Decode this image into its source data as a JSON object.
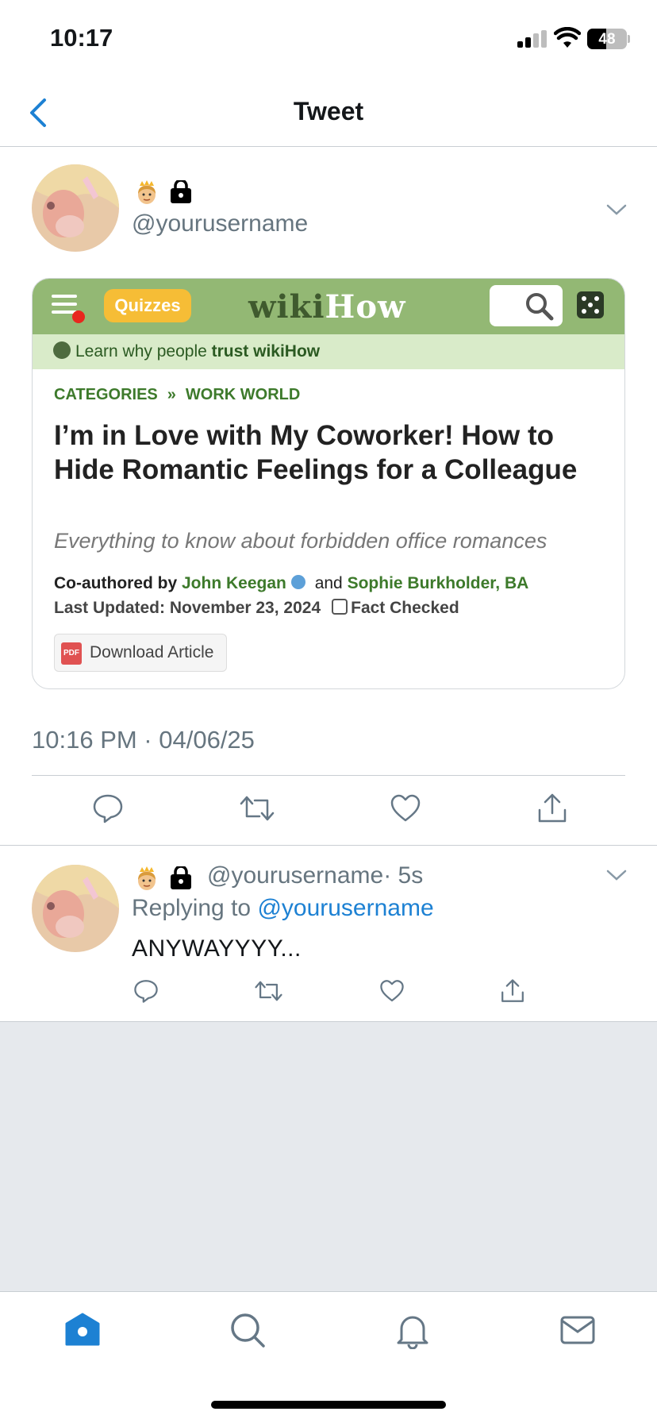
{
  "status_bar": {
    "time": "10:17",
    "battery": "48",
    "battery_level": 0.48
  },
  "header": {
    "title": "Tweet",
    "back_icon": "chevron-left-icon"
  },
  "colors": {
    "accent": "#1d81d3",
    "secondary_text": "#66757f",
    "wikihow_green": "#93b874"
  },
  "main_tweet": {
    "badges": [
      "princess-emoji",
      "lock-icon"
    ],
    "handle": "@yourusername",
    "timestamp": "10:16 PM · 04/06/25",
    "article": {
      "quizzes_label": "Quizzes",
      "logo_wiki": "wiki",
      "logo_how": "How",
      "trust_prefix": "Learn why people ",
      "trust_bold": "trust wikiHow",
      "crumb_1": "CATEGORIES",
      "crumb_sep": "»",
      "crumb_2": "WORK WORLD",
      "title": "I’m in Love with My Coworker! How to Hide Romantic Feelings for a Colleague",
      "subtitle": "Everything to know about forbidden office romances",
      "coauthored_prefix": "Co-authored by ",
      "author_1": "John Keegan",
      "and": " and ",
      "author_2": "Sophie Burkholder, BA",
      "last_updated": "Last Updated: November 23, 2024",
      "fact_checked": "Fact Checked",
      "pdf_label": "PDF",
      "download_label": "Download Article"
    },
    "actions": [
      "reply-icon",
      "retweet-icon",
      "like-icon",
      "share-icon"
    ]
  },
  "reply_tweet": {
    "handle": "@yourusername",
    "time": "· 5s",
    "replying_prefix": "Replying to ",
    "replying_to": "@yourusername",
    "text": "ANYWAYYYY..."
  },
  "tab_bar": {
    "tabs": [
      "home-icon",
      "search-icon",
      "notifications-icon",
      "messages-icon"
    ],
    "active": "home-icon"
  }
}
